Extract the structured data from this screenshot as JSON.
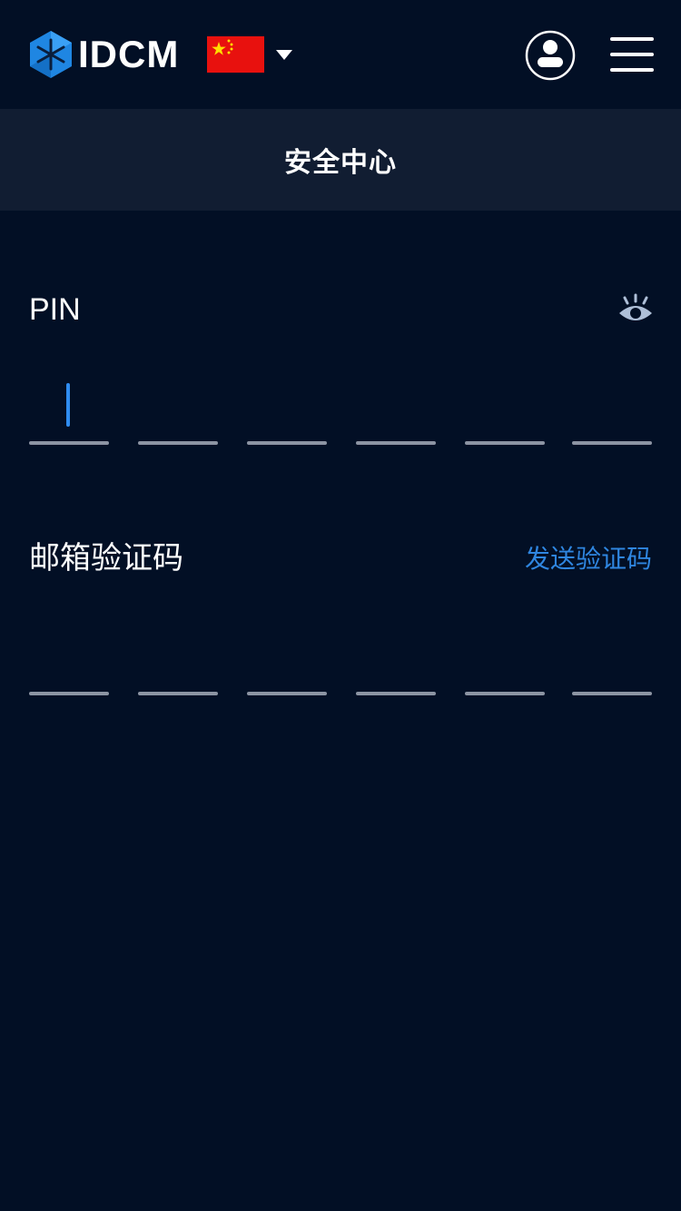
{
  "header": {
    "brand": "IDCM",
    "logo_icon": "idcm-logo-icon",
    "language_flag": "china-flag-icon",
    "language_dropdown_icon": "caret-down-icon",
    "user_icon": "user-profile-icon",
    "menu_icon": "hamburger-menu-icon"
  },
  "title_bar": {
    "title": "安全中心"
  },
  "pin": {
    "label": "PIN",
    "visibility_icon": "eye-icon",
    "digits": [
      "",
      "",
      "",
      "",
      "",
      ""
    ],
    "active_index": 0
  },
  "email_code": {
    "label": "邮箱验证码",
    "send_label": "发送验证码",
    "digits": [
      "",
      "",
      "",
      "",
      "",
      ""
    ]
  },
  "colors": {
    "background": "#020f25",
    "title_bar": "#111d32",
    "accent": "#2f86e0",
    "caret": "#2f8cf0",
    "underline": "#8c94a3"
  }
}
